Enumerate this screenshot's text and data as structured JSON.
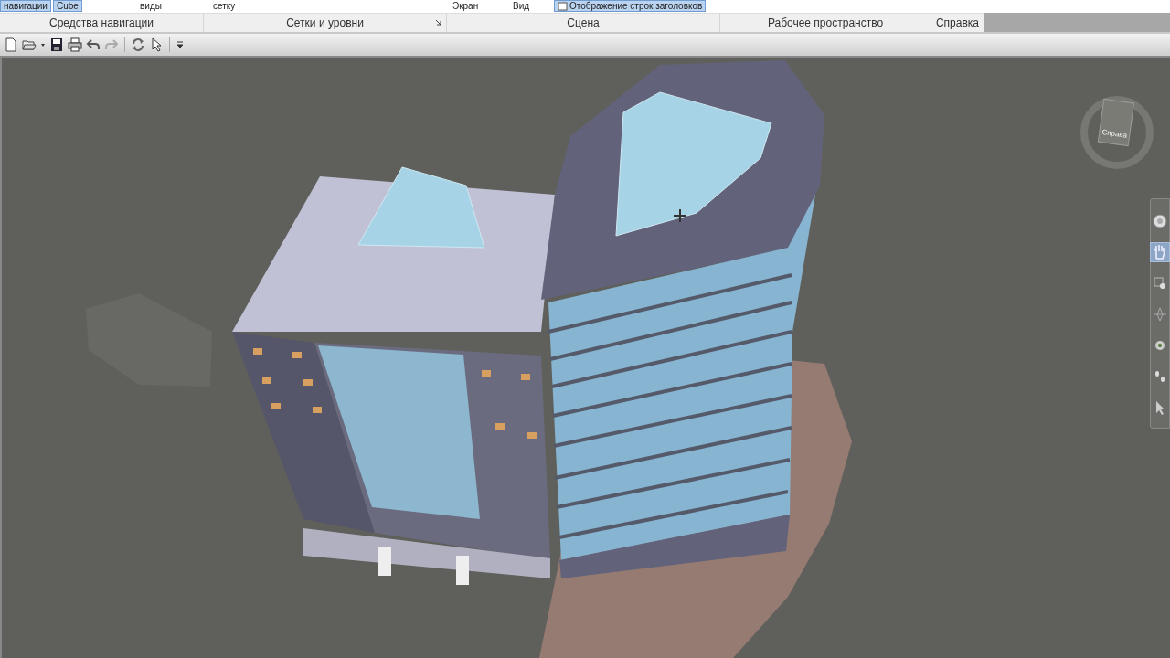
{
  "ribbon": {
    "top_row": [
      {
        "label": "навигации",
        "selected": true
      },
      {
        "label": "Cube",
        "selected": true
      },
      {
        "label": "виды",
        "selected": false
      },
      {
        "label": "сетку",
        "selected": false
      },
      {
        "label": "Экран",
        "selected": false
      },
      {
        "label": "Вид",
        "selected": false
      },
      {
        "label": "Отображение строк заголовков",
        "selected": true
      }
    ],
    "panels": [
      {
        "label": "Средства навигации",
        "launcher": false
      },
      {
        "label": "Сетки и уровни",
        "launcher": true
      },
      {
        "label": "Сцена",
        "launcher": false
      },
      {
        "label": "Рабочее пространство",
        "launcher": false
      },
      {
        "label": "Справка",
        "launcher": false
      }
    ]
  },
  "viewcube": {
    "face_label": "Справа"
  },
  "nav_bar": {
    "tools": [
      {
        "kind": "wheel",
        "selected": false
      },
      {
        "kind": "pan",
        "selected": true
      },
      {
        "kind": "zoom",
        "selected": false
      },
      {
        "kind": "orbit",
        "selected": false
      },
      {
        "kind": "look",
        "selected": false
      },
      {
        "kind": "walk",
        "selected": false
      },
      {
        "kind": "select",
        "selected": false
      }
    ]
  }
}
